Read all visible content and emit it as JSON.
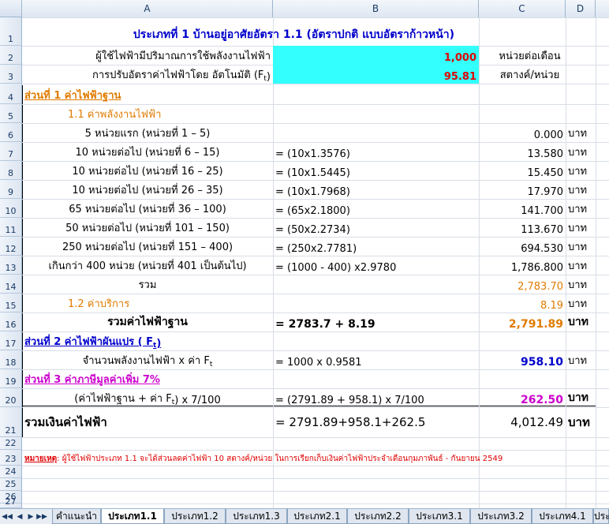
{
  "columns": [
    "A",
    "B",
    "C",
    "D"
  ],
  "rows": [
    "1",
    "2",
    "3",
    "4",
    "5",
    "6",
    "7",
    "8",
    "9",
    "10",
    "11",
    "12",
    "13",
    "14",
    "15",
    "16",
    "17",
    "18",
    "19",
    "20",
    "21",
    "22",
    "23",
    "24",
    "25",
    "26",
    "27"
  ],
  "title": "ประเภทที่ 1   บ้านอยู่อาศัยอัตรา 1.1 (อัตราปกติ แบบอัตราก้าวหน้า)",
  "usage": {
    "label": "ผู้ใช้ไฟฟ้ามีปริมาณการใช้พลังงานไฟฟ้า",
    "value": "1,000",
    "unit": "หน่วยต่อเดือน"
  },
  "ft": {
    "label": "การปรับอัตราค่าไฟฟ้าโดย อัตโนมัติ (F",
    "sub": "t",
    "close": ")",
    "value": "95.81",
    "unit": "สตางค์/หน่วย"
  },
  "section1": {
    "title": "ส่วนที่ 1 ค่าไฟฟ้าฐาน",
    "sub1": "1.1 ค่าพลังงานไฟฟ้า"
  },
  "tiers": [
    {
      "label": "5 หน่วยแรก (หน่วยที่ 1 – 5)",
      "formula": "",
      "amount": "0.000",
      "unit": "บาท"
    },
    {
      "label": "10 หน่วยต่อไป (หน่วยที่ 6 – 15)",
      "formula": "= (10x1.3576)",
      "amount": "13.580",
      "unit": "บาท"
    },
    {
      "label": "10 หน่วยต่อไป (หน่วยที่ 16 – 25)",
      "formula": "= (10x1.5445)",
      "amount": "15.450",
      "unit": "บาท"
    },
    {
      "label": "10 หน่วยต่อไป (หน่วยที่ 26 – 35)",
      "formula": "= (10x1.7968)",
      "amount": "17.970",
      "unit": "บาท"
    },
    {
      "label": "65 หน่วยต่อไป (หน่วยที่ 36 – 100)",
      "formula": "= (65x2.1800)",
      "amount": "141.700",
      "unit": "บาท"
    },
    {
      "label": "50 หน่วยต่อไป (หน่วยที่ 101 – 150)",
      "formula": "= (50x2.2734)",
      "amount": "113.670",
      "unit": "บาท"
    },
    {
      "label": "250 หน่วยต่อไป (หน่วยที่ 151 – 400)",
      "formula": "= (250x2.7781)",
      "amount": "694.530",
      "unit": "บาท"
    },
    {
      "label": "เกินกว่า 400 หน่วย (หน่วยที่ 401 เป็นต้นไป)",
      "formula": "= (1000 - 400) x2.9780",
      "amount": "1,786.800",
      "unit": "บาท"
    }
  ],
  "subtotal": {
    "label": "รวม",
    "amount": "2,783.70",
    "unit": "บาท"
  },
  "service": {
    "label": "1.2 ค่าบริการ",
    "amount": "8.19",
    "unit": "บาท"
  },
  "base_total": {
    "label": "รวมค่าไฟฟ้าฐาน",
    "formula": "= 2783.7 + 8.19",
    "amount": "2,791.89",
    "unit": "บาท"
  },
  "section2": {
    "title": "ส่วนที่ 2 ค่าไฟฟ้าผันแปร ( F",
    "sub": "t",
    "close": " )"
  },
  "ft_row": {
    "label": "จำนวนพลังงานไฟฟ้า x ค่า F",
    "sub": "t",
    "formula": "= 1000 x 0.9581",
    "amount": "958.10",
    "unit": "บาท"
  },
  "section3": {
    "title": "ส่วนที่ 3 ค่าภาษีมูลค่าเพิ่ม 7%"
  },
  "vat_row": {
    "label": "(ค่าไฟฟ้าฐาน + ค่า F",
    "sub": "t",
    "close": ") x 7/100",
    "formula": "= (2791.89 + 958.1) x 7/100",
    "amount": "262.50",
    "unit": "บาท"
  },
  "grand_total": {
    "label": "รวมเงินค่าไฟฟ้า",
    "formula": "= 2791.89+958.1+262.5",
    "amount": "4,012.49",
    "unit": "บาท"
  },
  "note": {
    "prefix": "หมายเหตุ",
    "text": " : ผู้ใช้ไฟฟ้าประเภท 1.1 จะได้ส่วนลดค่าไฟฟ้า 10 สตางค์/หน่วย ในการเรียกเก็บเงินค่าไฟฟ้าประจำเดือนกุมภาพันธ์ - กันยายน 2549"
  },
  "tabs": [
    "คำแนะนำ",
    "ประเภท1.1",
    "ประเภท1.2",
    "ประเภท1.3",
    "ประเภท2.1",
    "ประเภท2.2",
    "ประเภท3.1",
    "ประเภท3.2",
    "ประเภท4.1",
    "ประเ"
  ],
  "nav": [
    "◀◀",
    "◀",
    "▶",
    "▶▶"
  ],
  "colors": {
    "cyan": "#33ffff",
    "orange": "#e07b00",
    "blue": "#0000cc",
    "magenta": "#cc00cc",
    "red": "#e00000"
  }
}
